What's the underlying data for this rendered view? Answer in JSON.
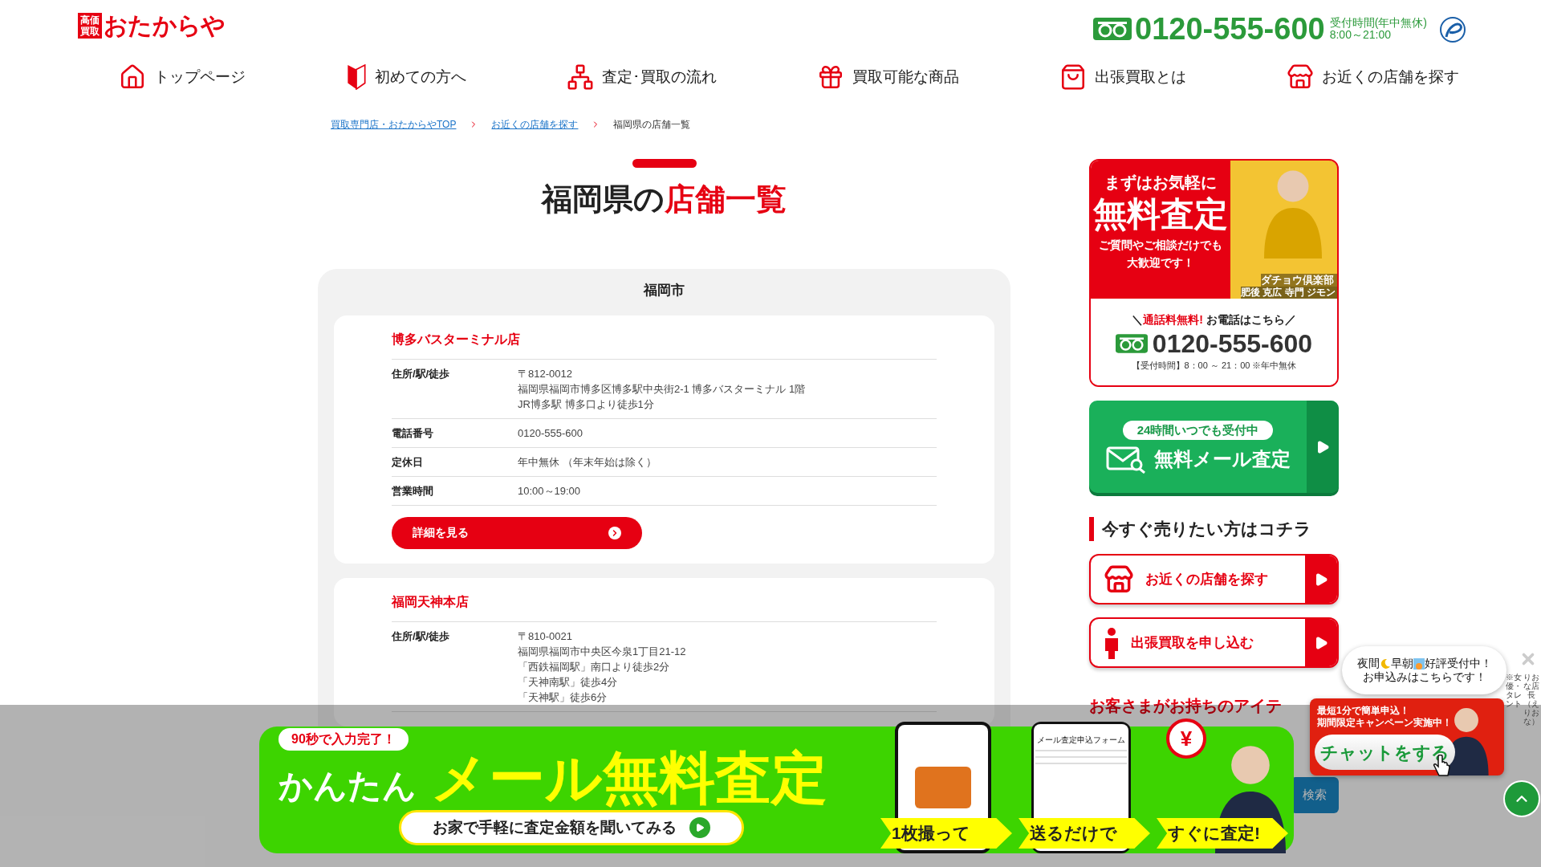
{
  "header": {
    "logo_badge": [
      "高価",
      "買取"
    ],
    "logo": "おたからや",
    "phone": "0120-555-600",
    "hours_label": "受付時間(年中無休)",
    "hours": "8:00～21:00"
  },
  "nav": [
    {
      "label": "トップページ",
      "kind": "home"
    },
    {
      "label": "初めての方へ",
      "kind": "beginner"
    },
    {
      "label": "査定･買取の流れ",
      "kind": "flow"
    },
    {
      "label": "買取可能な商品",
      "kind": "products"
    },
    {
      "label": "出張買取とは",
      "kind": "visit"
    },
    {
      "label": "お近くの店舗を探す",
      "kind": "store"
    }
  ],
  "breadcrumb": [
    {
      "label": "買取専門店・おたからやTOP",
      "link": true
    },
    {
      "label": "お近くの店舗を探す",
      "link": true
    },
    {
      "label": "福岡県の店舗一覧",
      "link": false
    }
  ],
  "title": {
    "plain": "福岡県の",
    "accent": "店舗一覧"
  },
  "area": "福岡市",
  "stores": [
    {
      "name": "博多バスターミナル店",
      "rows": [
        {
          "label": "住所/駅/徒歩",
          "lines": [
            "〒812-0012",
            "福岡県福岡市博多区博多駅中央街2-1 博多バスターミナル 1階",
            "JR博多駅 博多口より徒歩1分"
          ]
        },
        {
          "label": "電話番号",
          "lines": [
            "0120-555-600"
          ]
        },
        {
          "label": "定休日",
          "lines": [
            "年中無休 （年末年始は除く）"
          ]
        },
        {
          "label": "営業時間",
          "lines": [
            "10:00～19:00"
          ]
        }
      ],
      "button": "詳細を見る"
    },
    {
      "name": "福岡天神本店",
      "rows": [
        {
          "label": "住所/駅/徒歩",
          "lines": [
            "〒810-0021",
            "福岡県福岡市中央区今泉1丁目21-12",
            "「西鉄福岡駅」南口より徒歩2分",
            "「天神南駅」徒歩4分",
            "「天神駅」徒歩6分"
          ]
        }
      ]
    }
  ],
  "sidebar": {
    "promo": {
      "lead": "まずはお気軽に",
      "headline": "無料査定",
      "sub": [
        "ご質問やご相談だけでも",
        "大歓迎です！"
      ],
      "caption": "ダチョウ倶楽部",
      "caption_names": "肥後 克広 寺門 ジモン",
      "call_open": "＼",
      "call_accent": "通話料無料!",
      "call": "お電話はこちら",
      "call_close": "／",
      "phone": "0120-555-600",
      "hours": "【受付時間】8：00 ～ 21：00 ※年中無休"
    },
    "mail": {
      "badge": "24時間いつでも受付中",
      "label": "無料メール査定"
    },
    "heading": "今すぐ売りたい方はコチラ",
    "links": [
      {
        "label": "お近くの店舗を探す",
        "kind": "store"
      },
      {
        "label": "出張買取を申し込む",
        "kind": "staff"
      }
    ],
    "next_heading": "お客さまがお持ちのアイテ",
    "search_button": "検索"
  },
  "banner": {
    "badge": "90秒で入力完了！",
    "lead": "かんたん",
    "headline": "メール無料査定",
    "cta": "お家で手軽に査定金額を聞いてみる",
    "form_title": "メール査定申込フォーム",
    "price_mark": "¥",
    "steps": [
      "1枚撮って",
      "送るだけで",
      "すぐに査定!"
    ]
  },
  "chat": {
    "bubble_segments": [
      "夜間",
      "早朝",
      "好評受付中！"
    ],
    "bubble_line2": "お申込みはこちらです！",
    "promo": [
      "最短**1**分で簡単申込！",
      "期間限定キャンペーン実施中！"
    ],
    "button": "チャットをする",
    "vertical": [
      "※女優・タレント",
      "りおな店長（えりおな）"
    ]
  }
}
